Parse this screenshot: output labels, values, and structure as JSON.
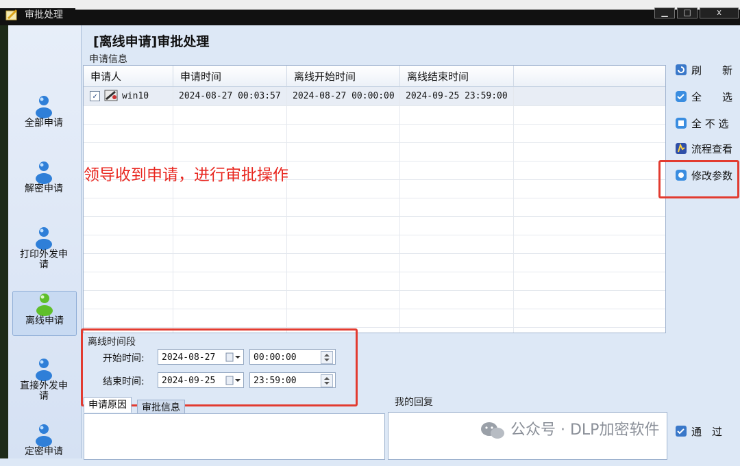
{
  "window": {
    "title": "审批处理",
    "min": "▁",
    "max": "□",
    "close": "x"
  },
  "nav": [
    {
      "label": "全部申请"
    },
    {
      "label": "解密申请"
    },
    {
      "label": "打印外发申请"
    },
    {
      "label": "离线申请"
    },
    {
      "label": "直接外发申请"
    },
    {
      "label": "定密申请"
    }
  ],
  "page_title": "[离线申请]审批处理",
  "apply_info_label": "申请信息",
  "table": {
    "columns": [
      "申请人",
      "申请时间",
      "离线开始时间",
      "离线结束时间"
    ],
    "rows": [
      {
        "checked": "✓",
        "applicant": "win10",
        "apply_time": "2024-08-27 00:03:57",
        "start": "2024-08-27 00:00:00",
        "end": "2024-09-25 23:59:00"
      }
    ]
  },
  "annotation": "领导收到申请，进行审批操作",
  "side_buttons": [
    {
      "label": "刷　　新"
    },
    {
      "label": "全　　选"
    },
    {
      "label": "全 不 选"
    },
    {
      "label": "流程查看"
    },
    {
      "label": "修改参数"
    }
  ],
  "offline_period": {
    "group_label": "离线时间段",
    "start_label": "开始时间:",
    "start_date": "2024-08-27",
    "start_time": "00:00:00",
    "end_label": "结束时间:",
    "end_date": "2024-09-25",
    "end_time": "23:59:00"
  },
  "tabs": [
    "申请原因",
    "审批信息"
  ],
  "reply_label": "我的回复",
  "pass_button": "通　过",
  "watermark": "公众号 · DLP加密软件",
  "colors": {
    "annotation_red": "#e8261f",
    "box_red": "#e23b30",
    "panel_bg": "#dde8f6"
  }
}
